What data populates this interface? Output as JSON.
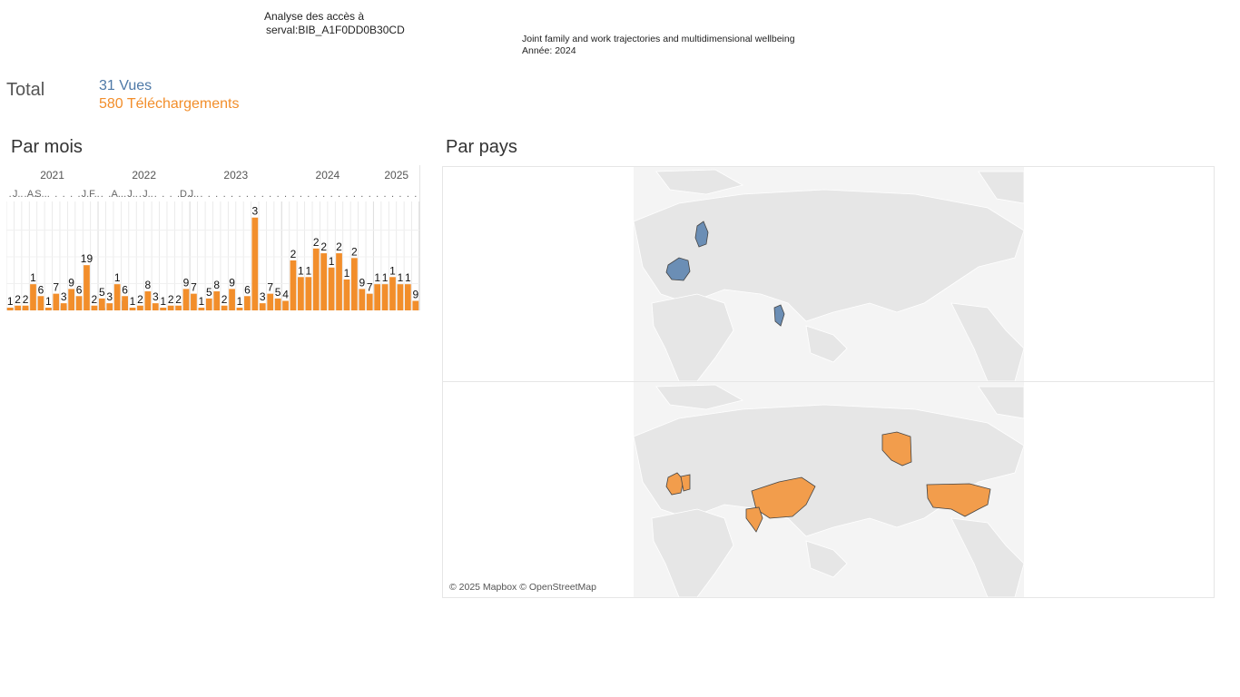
{
  "header": {
    "title_line1": "Analyse des accès à",
    "title_line2": "serval:BIB_A1F0DD0B30CD",
    "pub_title": "Joint family and work trajectories and multidimensional wellbeing",
    "pub_year": "Année: 2024"
  },
  "totals": {
    "label": "Total",
    "views": "31 Vues",
    "downloads": "580 Téléchargements"
  },
  "sections": {
    "by_month": "Par mois",
    "by_country": "Par pays"
  },
  "map": {
    "credit": "© 2025 Mapbox © OpenStreetMap"
  },
  "colors": {
    "views": "#4e79a7",
    "downloads": "#f28e2b",
    "map_land": "#e8e8e8",
    "map_highlight_views": "#6b8eb5",
    "map_highlight_downloads": "#f29d4c"
  },
  "chart_data": {
    "type": "bar",
    "title": "Par mois",
    "years": [
      {
        "label": "2021",
        "months": 12
      },
      {
        "label": "2022",
        "months": 12
      },
      {
        "label": "2023",
        "months": 12
      },
      {
        "label": "2024",
        "months": 12
      },
      {
        "label": "2025",
        "months": 6
      }
    ],
    "month_labels": [
      ".",
      "J..",
      "",
      "A..",
      "S..",
      "",
      "",
      "",
      "",
      "",
      "J..",
      "F..",
      ".",
      "",
      "A..",
      "",
      "J..",
      "",
      "J..",
      "",
      "",
      "",
      "",
      "D..",
      "J..",
      "",
      "",
      "",
      "",
      "",
      "",
      "",
      "",
      "",
      "",
      "",
      "",
      "",
      "",
      "",
      "",
      "",
      "",
      "",
      "",
      "",
      "",
      "",
      "",
      "",
      "",
      "",
      "",
      ""
    ],
    "series": [
      {
        "name": "Vues",
        "color": "#4e79a7",
        "values": [
          1,
          0,
          1,
          0,
          0,
          1,
          0,
          2,
          0,
          0,
          0,
          0,
          1,
          0,
          0,
          4,
          0,
          0,
          0,
          0,
          1,
          0,
          0,
          0,
          0,
          0,
          0,
          0,
          0,
          0,
          0,
          0,
          0,
          0,
          0,
          0,
          0,
          0,
          0,
          0,
          0,
          0,
          0,
          0,
          0,
          0,
          0,
          0,
          0,
          0,
          0,
          0,
          0,
          0
        ]
      },
      {
        "name": "Téléchargements",
        "color": "#f28e2b",
        "values": [
          1,
          2,
          2,
          11,
          6,
          1,
          7,
          3,
          9,
          6,
          19,
          2,
          5,
          3,
          11,
          6,
          1,
          2,
          8,
          3,
          1,
          2,
          2,
          9,
          7,
          1,
          5,
          8,
          2,
          9,
          1,
          6,
          39,
          3,
          7,
          5,
          4,
          21,
          14,
          14,
          26,
          24,
          18,
          24,
          13,
          22,
          9,
          7,
          11,
          11,
          14,
          11,
          11,
          4
        ]
      }
    ],
    "data_labels": [
      "1",
      "2",
      "2",
      "1",
      "6",
      "1",
      "7",
      "3",
      "9",
      "6",
      "19",
      "2",
      "5",
      "3",
      "1",
      "6",
      "1",
      "2",
      "8",
      "3",
      "1",
      "2",
      "2",
      "9",
      "7",
      "1",
      "5",
      "8",
      "2",
      "9",
      "1",
      "6",
      "3",
      "3",
      "7",
      "5",
      "4",
      "2",
      "1",
      "1",
      "2",
      "2",
      "1",
      "2",
      "1",
      "2",
      "9",
      "7",
      "1",
      "1",
      "1",
      "1",
      "1",
      "9",
      "2",
      "1",
      "2",
      "1",
      "4"
    ],
    "ylim": [
      0,
      45
    ]
  }
}
